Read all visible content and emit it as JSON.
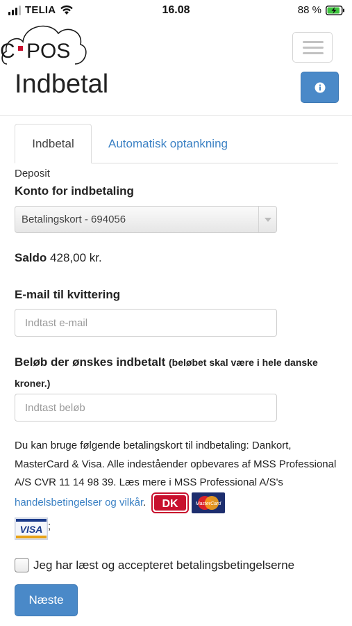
{
  "status_bar": {
    "carrier": "TELIA",
    "time": "16.08",
    "battery": "88 %"
  },
  "header": {
    "logo_text": "C·POS",
    "title": "Indbetal"
  },
  "tabs": [
    {
      "label": "Indbetal",
      "active": true
    },
    {
      "label": "Automatisk optankning",
      "active": false
    }
  ],
  "form": {
    "section_label": "Deposit",
    "account_label": "Konto for indbetaling",
    "account_value": "Betalingskort - 694056",
    "balance_label": "Saldo",
    "balance_value": "428,00 kr.",
    "email_label": "E-mail til kvittering",
    "email_placeholder": "Indtast e-mail",
    "amount_label": "Beløb der ønskes indbetalt",
    "amount_note": "(beløbet skal være i hele danske kroner.)",
    "amount_placeholder": "Indtast beløb",
    "info_text": "Du kan bruge følgende betalingskort til indbetaling: Dankort, MasterCard & Visa. Alle indeståender opbevares af MSS Professional A/S CVR 11 14 98 39. Læs mere i MSS Professional A/S's ",
    "terms_link": "handelsbetingelser og vilkår",
    "info_text_end": ".",
    "after_cards": ";",
    "card_dk": "DK",
    "card_mastercard": "MasterCard",
    "card_visa": "VISA",
    "checkbox_label": "Jeg har læst og accepteret betalingsbetingelserne",
    "next_button": "Næste"
  },
  "colors": {
    "primary": "#4a89c8",
    "link": "#3b81c4",
    "logo_red": "#c8102e"
  }
}
